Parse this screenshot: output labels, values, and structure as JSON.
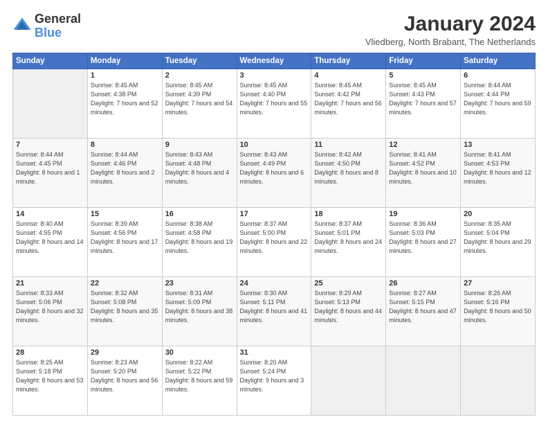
{
  "logo": {
    "line1": "General",
    "line2": "Blue"
  },
  "title": "January 2024",
  "subtitle": "Vliedberg, North Brabant, The Netherlands",
  "header": {
    "days": [
      "Sunday",
      "Monday",
      "Tuesday",
      "Wednesday",
      "Thursday",
      "Friday",
      "Saturday"
    ]
  },
  "weeks": [
    [
      {
        "day": "",
        "sunrise": "",
        "sunset": "",
        "daylight": ""
      },
      {
        "day": "1",
        "sunrise": "Sunrise: 8:45 AM",
        "sunset": "Sunset: 4:38 PM",
        "daylight": "Daylight: 7 hours and 52 minutes."
      },
      {
        "day": "2",
        "sunrise": "Sunrise: 8:45 AM",
        "sunset": "Sunset: 4:39 PM",
        "daylight": "Daylight: 7 hours and 54 minutes."
      },
      {
        "day": "3",
        "sunrise": "Sunrise: 8:45 AM",
        "sunset": "Sunset: 4:40 PM",
        "daylight": "Daylight: 7 hours and 55 minutes."
      },
      {
        "day": "4",
        "sunrise": "Sunrise: 8:45 AM",
        "sunset": "Sunset: 4:42 PM",
        "daylight": "Daylight: 7 hours and 56 minutes."
      },
      {
        "day": "5",
        "sunrise": "Sunrise: 8:45 AM",
        "sunset": "Sunset: 4:43 PM",
        "daylight": "Daylight: 7 hours and 57 minutes."
      },
      {
        "day": "6",
        "sunrise": "Sunrise: 8:44 AM",
        "sunset": "Sunset: 4:44 PM",
        "daylight": "Daylight: 7 hours and 59 minutes."
      }
    ],
    [
      {
        "day": "7",
        "sunrise": "Sunrise: 8:44 AM",
        "sunset": "Sunset: 4:45 PM",
        "daylight": "Daylight: 8 hours and 1 minute."
      },
      {
        "day": "8",
        "sunrise": "Sunrise: 8:44 AM",
        "sunset": "Sunset: 4:46 PM",
        "daylight": "Daylight: 8 hours and 2 minutes."
      },
      {
        "day": "9",
        "sunrise": "Sunrise: 8:43 AM",
        "sunset": "Sunset: 4:48 PM",
        "daylight": "Daylight: 8 hours and 4 minutes."
      },
      {
        "day": "10",
        "sunrise": "Sunrise: 8:43 AM",
        "sunset": "Sunset: 4:49 PM",
        "daylight": "Daylight: 8 hours and 6 minutes."
      },
      {
        "day": "11",
        "sunrise": "Sunrise: 8:42 AM",
        "sunset": "Sunset: 4:50 PM",
        "daylight": "Daylight: 8 hours and 8 minutes."
      },
      {
        "day": "12",
        "sunrise": "Sunrise: 8:41 AM",
        "sunset": "Sunset: 4:52 PM",
        "daylight": "Daylight: 8 hours and 10 minutes."
      },
      {
        "day": "13",
        "sunrise": "Sunrise: 8:41 AM",
        "sunset": "Sunset: 4:53 PM",
        "daylight": "Daylight: 8 hours and 12 minutes."
      }
    ],
    [
      {
        "day": "14",
        "sunrise": "Sunrise: 8:40 AM",
        "sunset": "Sunset: 4:55 PM",
        "daylight": "Daylight: 8 hours and 14 minutes."
      },
      {
        "day": "15",
        "sunrise": "Sunrise: 8:39 AM",
        "sunset": "Sunset: 4:56 PM",
        "daylight": "Daylight: 8 hours and 17 minutes."
      },
      {
        "day": "16",
        "sunrise": "Sunrise: 8:38 AM",
        "sunset": "Sunset: 4:58 PM",
        "daylight": "Daylight: 8 hours and 19 minutes."
      },
      {
        "day": "17",
        "sunrise": "Sunrise: 8:37 AM",
        "sunset": "Sunset: 5:00 PM",
        "daylight": "Daylight: 8 hours and 22 minutes."
      },
      {
        "day": "18",
        "sunrise": "Sunrise: 8:37 AM",
        "sunset": "Sunset: 5:01 PM",
        "daylight": "Daylight: 8 hours and 24 minutes."
      },
      {
        "day": "19",
        "sunrise": "Sunrise: 8:36 AM",
        "sunset": "Sunset: 5:03 PM",
        "daylight": "Daylight: 8 hours and 27 minutes."
      },
      {
        "day": "20",
        "sunrise": "Sunrise: 8:35 AM",
        "sunset": "Sunset: 5:04 PM",
        "daylight": "Daylight: 8 hours and 29 minutes."
      }
    ],
    [
      {
        "day": "21",
        "sunrise": "Sunrise: 8:33 AM",
        "sunset": "Sunset: 5:06 PM",
        "daylight": "Daylight: 8 hours and 32 minutes."
      },
      {
        "day": "22",
        "sunrise": "Sunrise: 8:32 AM",
        "sunset": "Sunset: 5:08 PM",
        "daylight": "Daylight: 8 hours and 35 minutes."
      },
      {
        "day": "23",
        "sunrise": "Sunrise: 8:31 AM",
        "sunset": "Sunset: 5:09 PM",
        "daylight": "Daylight: 8 hours and 38 minutes."
      },
      {
        "day": "24",
        "sunrise": "Sunrise: 8:30 AM",
        "sunset": "Sunset: 5:11 PM",
        "daylight": "Daylight: 8 hours and 41 minutes."
      },
      {
        "day": "25",
        "sunrise": "Sunrise: 8:29 AM",
        "sunset": "Sunset: 5:13 PM",
        "daylight": "Daylight: 8 hours and 44 minutes."
      },
      {
        "day": "26",
        "sunrise": "Sunrise: 8:27 AM",
        "sunset": "Sunset: 5:15 PM",
        "daylight": "Daylight: 8 hours and 47 minutes."
      },
      {
        "day": "27",
        "sunrise": "Sunrise: 8:26 AM",
        "sunset": "Sunset: 5:16 PM",
        "daylight": "Daylight: 8 hours and 50 minutes."
      }
    ],
    [
      {
        "day": "28",
        "sunrise": "Sunrise: 8:25 AM",
        "sunset": "Sunset: 5:18 PM",
        "daylight": "Daylight: 8 hours and 53 minutes."
      },
      {
        "day": "29",
        "sunrise": "Sunrise: 8:23 AM",
        "sunset": "Sunset: 5:20 PM",
        "daylight": "Daylight: 8 hours and 56 minutes."
      },
      {
        "day": "30",
        "sunrise": "Sunrise: 8:22 AM",
        "sunset": "Sunset: 5:22 PM",
        "daylight": "Daylight: 8 hours and 59 minutes."
      },
      {
        "day": "31",
        "sunrise": "Sunrise: 8:20 AM",
        "sunset": "Sunset: 5:24 PM",
        "daylight": "Daylight: 9 hours and 3 minutes."
      },
      {
        "day": "",
        "sunrise": "",
        "sunset": "",
        "daylight": ""
      },
      {
        "day": "",
        "sunrise": "",
        "sunset": "",
        "daylight": ""
      },
      {
        "day": "",
        "sunrise": "",
        "sunset": "",
        "daylight": ""
      }
    ]
  ]
}
